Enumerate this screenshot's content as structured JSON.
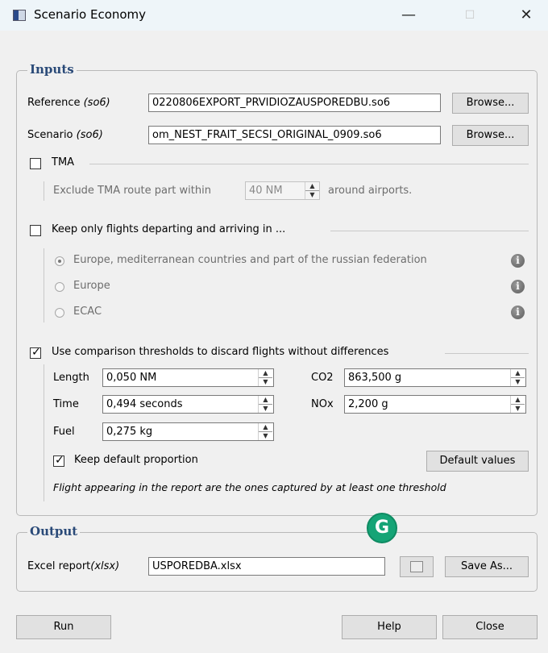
{
  "window": {
    "title": "Scenario Economy",
    "minimize_glyph": "—",
    "maximize_glyph": "☐",
    "close_glyph": "✕",
    "app_icon": "window-app-icon"
  },
  "inputs": {
    "title": "Inputs",
    "reference_label": "Reference",
    "reference_suffix": "(so6)",
    "reference_value": "0220806EXPORT_PRVIDIOZAUSPOREDBU.so6",
    "scenario_label": "Scenario",
    "scenario_suffix": "(so6)",
    "scenario_value": "om_NEST_FRAIT_SECSI_ORIGINAL_0909.so6",
    "browse_label": "Browse...",
    "tma": {
      "checkbox_label": "TMA",
      "checked": false,
      "exclude_prefix": "Exclude TMA route part within",
      "distance_value": "40 NM",
      "exclude_suffix": "around airports."
    },
    "flights": {
      "checkbox_label": "Keep only flights departing and arriving in ...",
      "checked": false,
      "options": [
        {
          "label": "Europe, mediterranean countries and part of the russian federation",
          "selected": true
        },
        {
          "label": "Europe",
          "selected": false
        },
        {
          "label": "ECAC",
          "selected": false
        }
      ],
      "info_glyph": "i"
    },
    "thresholds": {
      "checkbox_label": "Use comparison thresholds to discard flights without differences",
      "checked": true,
      "length_label": "Length",
      "length_value": "0,050 NM",
      "time_label": "Time",
      "time_value": "0,494 seconds",
      "fuel_label": "Fuel",
      "fuel_value": "0,275 kg",
      "co2_label": "CO2",
      "co2_value": "863,500 g",
      "nox_label": "NOx",
      "nox_value": "2,200 g",
      "keep_default_label": "Keep default proportion",
      "keep_default_checked": true,
      "default_values_label": "Default values",
      "note": "Flight appearing in the report are the ones captured by at least one threshold"
    }
  },
  "output": {
    "title": "Output",
    "excel_label": "Excel report",
    "excel_suffix": "(xlsx)",
    "excel_value": "USPOREDBA.xlsx",
    "save_as_label": "Save As...",
    "grammarly_glyph": "G"
  },
  "footer": {
    "run_label": "Run",
    "help_label": "Help",
    "close_label": "Close"
  },
  "colors": {
    "group_title": "#2a4a78",
    "grammarly": "#15a476",
    "dialog_bg": "#f0f0f0",
    "titlebar_bg": "#eef5f9"
  }
}
